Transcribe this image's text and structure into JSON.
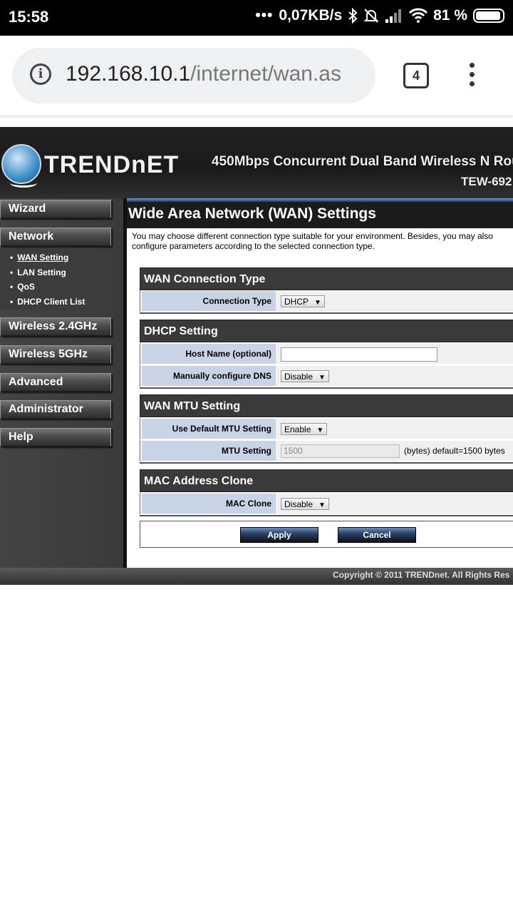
{
  "statusbar": {
    "time": "15:58",
    "dots": "•••",
    "speed": "0,07KB/s",
    "battery": "81 %"
  },
  "browser": {
    "url_host": "192.168.10.1",
    "url_path": "/internet/wan.as",
    "tab_count": "4"
  },
  "header": {
    "brand": "TRENDnET",
    "product": "450Mbps Concurrent Dual Band Wireless N Rou",
    "model": "TEW-692"
  },
  "sidebar": {
    "wizard": "Wizard",
    "network": "Network",
    "sub": [
      "WAN Setting",
      "LAN Setting",
      "QoS",
      "DHCP Client List"
    ],
    "wireless24": "Wireless 2.4GHz",
    "wireless5": "Wireless 5GHz",
    "advanced": "Advanced",
    "administrator": "Administrator",
    "help": "Help"
  },
  "main": {
    "title": "Wide Area Network (WAN) Settings",
    "description": "You may choose different connection type suitable for your environment. Besides, you may also configure parameters according to the selected connection type.",
    "wan_connection": {
      "heading": "WAN Connection Type",
      "label": "Connection Type",
      "value": "DHCP"
    },
    "dhcp": {
      "heading": "DHCP Setting",
      "host_label": "Host Name (optional)",
      "host_value": "",
      "dns_label": "Manually configure DNS",
      "dns_value": "Disable"
    },
    "mtu": {
      "heading": "WAN MTU Setting",
      "default_label": "Use Default MTU Setting",
      "default_value": "Enable",
      "mtu_label": "MTU Setting",
      "mtu_value": "1500",
      "mtu_note": "(bytes) default=1500 bytes"
    },
    "mac": {
      "heading": "MAC Address Clone",
      "label": "MAC Clone",
      "value": "Disable"
    },
    "apply": "Apply",
    "cancel": "Cancel"
  },
  "footer": {
    "copyright": "Copyright © 2011 TRENDnet. All Rights Res"
  }
}
